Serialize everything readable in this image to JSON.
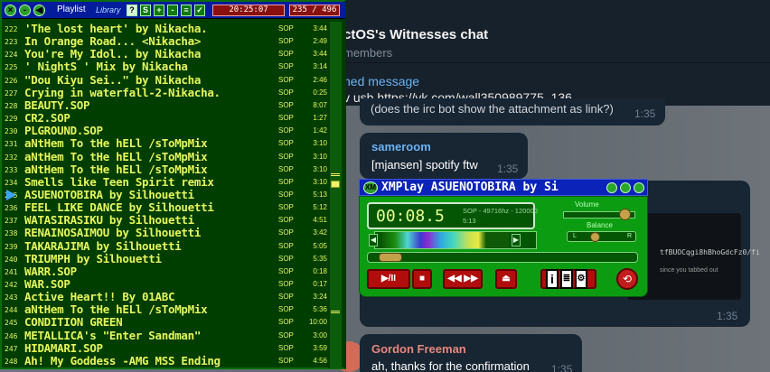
{
  "chat": {
    "title": "ctOS's Witnesses chat",
    "members": "members",
    "pinned_label": "ned message",
    "pinned_text": "v usb https://vk.com/wall350989775_136",
    "messages": [
      {
        "name": "",
        "text": "(does the irc bot show the attachment as link?)",
        "time": "1:35"
      },
      {
        "name": "sameroom",
        "text": "[mjansen] spotify ftw",
        "time": "1:35"
      },
      {
        "name": "",
        "preview_line1": "tfBUOCqgi8hBhoGdcFz0/fi",
        "preview_line2": "since you tabbed out",
        "time": "1:35"
      },
      {
        "name": "Gordon Freeman",
        "text": "ah, thanks for the confirmation",
        "time": "1:35"
      }
    ]
  },
  "playlist": {
    "title": "Playlist",
    "subtitle": "Library",
    "buttons": [
      "?",
      "S",
      "+",
      "-",
      "≡",
      "✓",
      "↕"
    ],
    "clock": "20:25:07",
    "position": "235 / 496",
    "rows": [
      {
        "num": "222",
        "title": "'The lost heart'   by Nikacha.",
        "fmt": "SOP",
        "dur": "3:44"
      },
      {
        "num": "223",
        "title": "In Orange Road... <Nikacha>",
        "fmt": "SOP",
        "dur": "2:49"
      },
      {
        "num": "224",
        "title": "You're My Idol..   by Nikacha",
        "fmt": "SOP",
        "dur": "3:44"
      },
      {
        "num": "225",
        "title": "' NightS ' Mix   by Nikacha",
        "fmt": "SOP",
        "dur": "3:14"
      },
      {
        "num": "226",
        "title": "\"Dou Kiyu Sei..\" by Nikacha",
        "fmt": "SOP",
        "dur": "2:46"
      },
      {
        "num": "227",
        "title": "Crying in waterfall-2-Nikacha.",
        "fmt": "SOP",
        "dur": "0:25"
      },
      {
        "num": "228",
        "title": "BEAUTY.SOP",
        "fmt": "SOP",
        "dur": "8:07"
      },
      {
        "num": "229",
        "title": "CR2.SOP",
        "fmt": "SOP",
        "dur": "1:27"
      },
      {
        "num": "230",
        "title": "PLGROUND.SOP",
        "fmt": "SOP",
        "dur": "1:42"
      },
      {
        "num": "231",
        "title": "aNtHem To tHe hELl /sToMpMix",
        "fmt": "SOP",
        "dur": "3:10"
      },
      {
        "num": "232",
        "title": "aNtHem To tHe hELl /sToMpMix",
        "fmt": "SOP",
        "dur": "3:10"
      },
      {
        "num": "233",
        "title": "aNtHem To tHe hELl /sToMpMix",
        "fmt": "SOP",
        "dur": "3:10"
      },
      {
        "num": "234",
        "title": "Smells like Teen Spirit remix",
        "fmt": "SOP",
        "dur": "3:10"
      },
      {
        "num": "235",
        "title": "ASUENOTOBIRA     by Silhouetti",
        "fmt": "SOP",
        "dur": "5:13"
      },
      {
        "num": "236",
        "title": "FEEL LIKE DANCE  by Silhouetti",
        "fmt": "SOP",
        "dur": "5:12"
      },
      {
        "num": "237",
        "title": "WATASIRASIKU     by Silhouetti",
        "fmt": "SOP",
        "dur": "4:51"
      },
      {
        "num": "238",
        "title": "RENAINOSAIMOU    by Silhouetti",
        "fmt": "SOP",
        "dur": "3:42"
      },
      {
        "num": "239",
        "title": "TAKARAJIMA       by Silhouetti",
        "fmt": "SOP",
        "dur": "5:05"
      },
      {
        "num": "240",
        "title": "TRIUMPH          by Silhouetti",
        "fmt": "SOP",
        "dur": "5:35"
      },
      {
        "num": "241",
        "title": "WARR.SOP",
        "fmt": "SOP",
        "dur": "0:18"
      },
      {
        "num": "242",
        "title": "WAR.SOP",
        "fmt": "SOP",
        "dur": "0:17"
      },
      {
        "num": "243",
        "title": "Active Heart!!       By 01ABC",
        "fmt": "SOP",
        "dur": "3:24"
      },
      {
        "num": "244",
        "title": "aNtHem To tHe hELl /sToMpMix",
        "fmt": "SOP",
        "dur": "5:36"
      },
      {
        "num": "245",
        "title": "CONDITION GREEN",
        "fmt": "SOP",
        "dur": "10:00"
      },
      {
        "num": "246",
        "title": "METALLICA's \"Enter Sandman\"",
        "fmt": "SOP",
        "dur": "3:00"
      },
      {
        "num": "247",
        "title": "HIDAMARI.SOP",
        "fmt": "SOP",
        "dur": "3:59"
      },
      {
        "num": "248",
        "title": "Ah! My Goddess -AMG MSS Ending",
        "fmt": "SOP",
        "dur": "4:56"
      }
    ]
  },
  "xmplay": {
    "title": "XMPlay  ASUENOTOBIRA     by Si",
    "logo": "XM",
    "time": "00:08.5",
    "info1": "SOP - 49716hz - 120000",
    "info2": "5:13",
    "volume_label": "Volume",
    "balance_label": "Balance",
    "bal_left": "L",
    "bal_right": "R",
    "volume_level": 0.85,
    "balance_level": 0.4,
    "seek_position": 0.027,
    "buttons": {
      "play_pause": "▶/II",
      "stop": "■",
      "prev_next": "◀◀ ▶▶",
      "eject": "⏏",
      "info": "i",
      "close": "⟲"
    }
  }
}
